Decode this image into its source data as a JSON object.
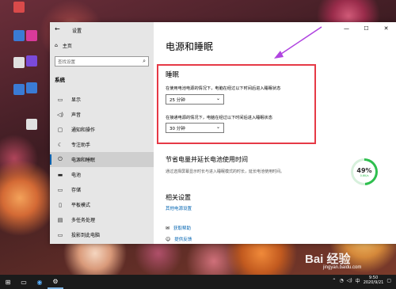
{
  "desktop": {
    "icons": [
      {
        "label": "",
        "color": "#d94a4a"
      },
      {
        "label": "",
        "color": "#3a7bd5"
      },
      {
        "label": "",
        "color": "#e0e0e0"
      },
      {
        "label": "",
        "color": "#3a7bd5"
      },
      {
        "label": "",
        "color": "#d93a9a"
      },
      {
        "label": "",
        "color": "#7a4ad9"
      },
      {
        "label": "",
        "color": "#3a7bd5"
      },
      {
        "label": "",
        "color": "#e0e0e0"
      }
    ]
  },
  "window": {
    "title": "设置",
    "controls": {
      "minimize": "—",
      "maximize": "☐",
      "close": "✕"
    }
  },
  "sidebar": {
    "home": "主页",
    "search_placeholder": "查找设置",
    "section": "系统",
    "items": [
      {
        "label": "显示",
        "icon": "display-icon",
        "glyph": "▭"
      },
      {
        "label": "声音",
        "icon": "sound-icon",
        "glyph": "◁)"
      },
      {
        "label": "通知和操作",
        "icon": "notification-icon",
        "glyph": "▢"
      },
      {
        "label": "专注助手",
        "icon": "focus-icon",
        "glyph": "☾"
      },
      {
        "label": "电源和睡眠",
        "icon": "power-icon",
        "glyph": "⏻"
      },
      {
        "label": "电池",
        "icon": "battery-icon",
        "glyph": "▬"
      },
      {
        "label": "存储",
        "icon": "storage-icon",
        "glyph": "▭"
      },
      {
        "label": "平板模式",
        "icon": "tablet-icon",
        "glyph": "▯"
      },
      {
        "label": "多任务处理",
        "icon": "multitask-icon",
        "glyph": "▤"
      },
      {
        "label": "投影到此电脑",
        "icon": "project-icon",
        "glyph": "▭"
      }
    ]
  },
  "main": {
    "title": "电源和睡眠",
    "sleep": {
      "heading": "睡眠",
      "battery_label": "在使用电池电源的情况下，电脑在经过以下时间后进入睡眠状态",
      "battery_value": "25 分钟",
      "plugged_label": "在接通电源的情况下，电脑在经过以下时间后进入睡眠状态",
      "plugged_value": "30 分钟"
    },
    "save": {
      "heading": "节省电量并延长电池使用时间",
      "desc": "通过选择屏幕显示时长与进入睡眠模式的时长，延长电池使用时间。"
    },
    "related": {
      "heading": "相关设置",
      "link": "其他电源设置"
    },
    "help": [
      {
        "label": "获取帮助",
        "icon": "help-icon"
      },
      {
        "label": "提供反馈",
        "icon": "feedback-icon"
      }
    ]
  },
  "battery_widget": {
    "percent": "49%",
    "rate": "0.6K/s",
    "level": 0.49
  },
  "taskbar": {
    "clock_time": "9:50",
    "clock_date": "2020/9/21",
    "language": "中"
  },
  "watermark": {
    "brand": "Bai 经验",
    "url": "jingyan.baidu.com"
  },
  "colors": {
    "accent": "#0063b1",
    "highlight_box": "#e63946",
    "battery_green": "#2fbf4f"
  }
}
